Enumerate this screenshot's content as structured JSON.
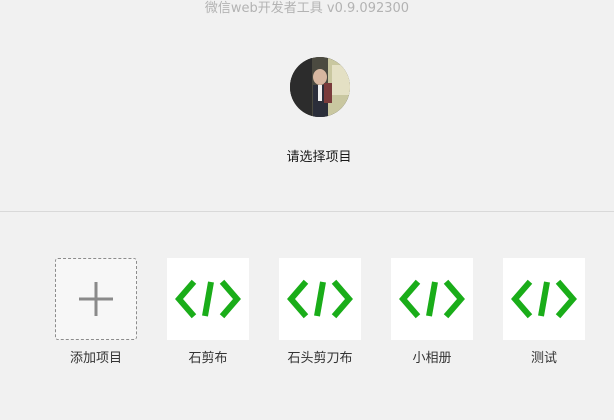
{
  "window": {
    "title": "微信web开发者工具 v0.9.092300"
  },
  "header": {
    "prompt": "请选择项目",
    "avatar_icon": "user-avatar"
  },
  "projects": {
    "add": {
      "label": "添加项目",
      "icon": "plus-icon"
    },
    "items": [
      {
        "label": "石剪布",
        "icon": "code-icon"
      },
      {
        "label": "石头剪刀布",
        "icon": "code-icon"
      },
      {
        "label": "小相册",
        "icon": "code-icon"
      },
      {
        "label": "测试",
        "icon": "code-icon"
      }
    ]
  },
  "colors": {
    "accent": "#1aad19",
    "background": "#f1f1f1",
    "tile": "#ffffff"
  }
}
